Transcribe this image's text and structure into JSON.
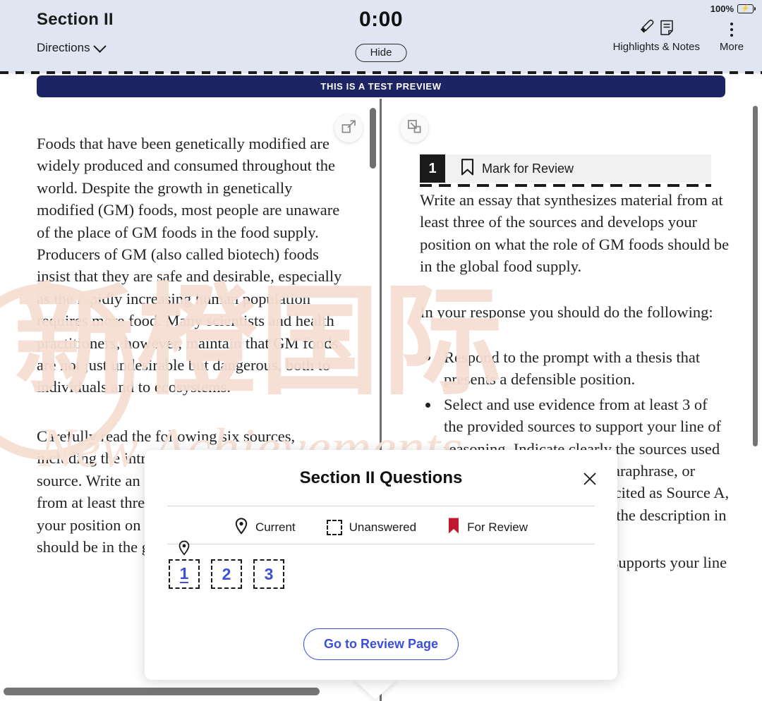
{
  "topbar": {
    "section_title": "Section II",
    "directions_label": "Directions",
    "timer": "0:00",
    "hide_label": "Hide",
    "battery_percent": "100%",
    "highlights_label": "Highlights & Notes",
    "more_label": "More"
  },
  "preview_banner": {
    "text": "THIS IS A TEST PREVIEW"
  },
  "left_pane": {
    "paragraph_1": "Foods that have been genetically modified are widely produced and consumed throughout the world. Despite the growth in genetically modified (GM) foods, most people are unaware of the place of GM foods in the food supply. Producers of GM (also called biotech) foods insist that they are safe and desirable, especially as the rapidly increasing human population requires more food. Many scientists and health practitioners, however, maintain that GM foods are not just undesirable but dangerous, both to individuals and to ecosystems.",
    "paragraph_2": "Carefully read the following six sources, including the introductory information for each source. Write an essay that synthesizes material from at least three of the sources and develops your position on what the role of GM foods should be in the global food supply."
  },
  "right_pane": {
    "question_number": "1",
    "mark_for_review_label": "Mark for Review",
    "prompt": "Write an essay that synthesizes material from at least three of the sources and develops your position on what the role of GM foods should be in the global food supply.",
    "instruction_lead": "In your response you should do the following:",
    "bullets": [
      "Respond to the prompt with a thesis that presents a defensible position.",
      "Select and use evidence from at least 3 of the provided sources to support your line of reasoning. Indicate clearly the sources used through direct quotation, paraphrase, or summary. Sources may be cited as Source A, Source B, etc., or by using the description in parentheses.",
      "Explain how the evidence supports your line of reasoning."
    ]
  },
  "modal": {
    "title": "Section II Questions",
    "close_label": "×",
    "legend": [
      {
        "icon": "location-pin-icon",
        "label": "Current"
      },
      {
        "icon": "dashed-square-icon",
        "label": "Unanswered"
      },
      {
        "icon": "bookmark-flag-icon",
        "label": "For Review"
      }
    ],
    "questions": [
      {
        "number": "1",
        "current": true
      },
      {
        "number": "2",
        "current": false
      },
      {
        "number": "3",
        "current": false
      }
    ],
    "review_button_label": "Go to Review Page"
  },
  "watermark": {
    "cjk_text": "新橙国际",
    "latin_text": "New Achievements"
  },
  "colors": {
    "topbar_bg": "#dfe6f2",
    "banner_bg": "#1d2463",
    "accent_blue": "#3b4fd8",
    "review_red": "#c0182f",
    "watermark": "#f6ded2"
  }
}
